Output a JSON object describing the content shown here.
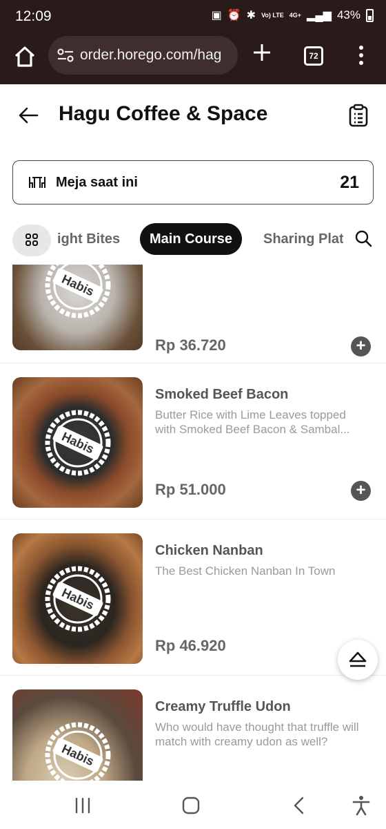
{
  "status_bar": {
    "time": "12:09",
    "network": "4G+",
    "volte": "Vo) LTE",
    "battery": "43%"
  },
  "browser": {
    "url": "order.horego.com/hag",
    "tab_count": "72"
  },
  "header": {
    "title": "Hagu Coffee & Space"
  },
  "table": {
    "label": "Meja saat ini",
    "number": "21"
  },
  "categories": {
    "items": [
      "ight Bites",
      "Main Course",
      "Sharing Plat"
    ],
    "active": "Main Course"
  },
  "menu": {
    "stamp_text": "Habis",
    "items": [
      {
        "name": "",
        "desc": "",
        "price": "Rp 36.720"
      },
      {
        "name": "Smoked Beef Bacon",
        "desc": "Butter Rice with Lime Leaves topped with Smoked Beef Bacon & Sambal...",
        "price": "Rp 51.000"
      },
      {
        "name": "Chicken Nanban",
        "desc": "The Best Chicken Nanban In Town",
        "price": "Rp 46.920"
      },
      {
        "name": "Creamy Truffle Udon",
        "desc": "Who would have thought that truffle will match with creamy udon as well?",
        "price": ""
      }
    ]
  },
  "colors": {
    "browser_bg": "#2a1a19",
    "accent": "#111111",
    "muted_text": "#9a9a9a"
  },
  "icons": [
    "home-icon",
    "tune-icon",
    "plus-icon",
    "tabs-icon",
    "more-vert-icon",
    "back-arrow-icon",
    "clipboard-icon",
    "table-icon",
    "grid-icon",
    "search-icon",
    "add-icon",
    "eject-icon",
    "recents-icon",
    "home-nav-icon",
    "back-nav-icon",
    "accessibility-icon"
  ]
}
